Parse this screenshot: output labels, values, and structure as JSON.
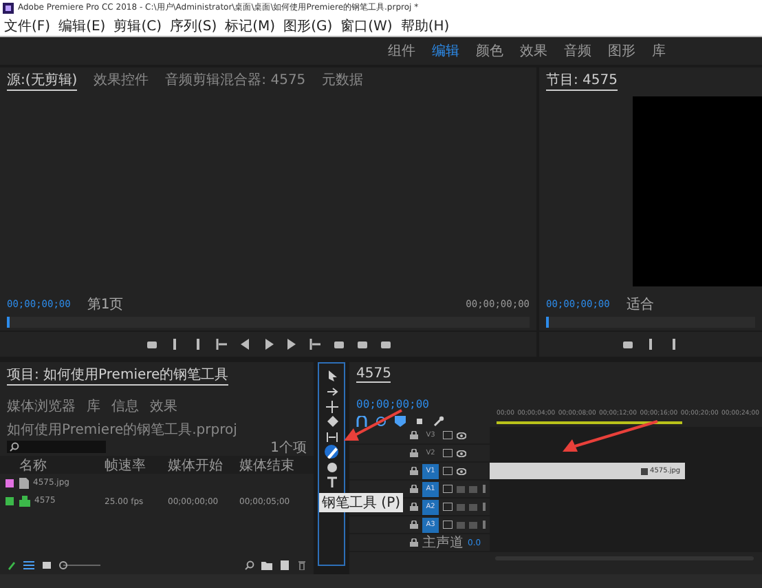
{
  "window": {
    "title": "Adobe Premiere Pro CC 2018 - C:\\用户\\Administrator\\桌面\\桌面\\如何使用Premiere的钢笔工具.prproj *"
  },
  "menu": [
    "文件(F)",
    "编辑(E)",
    "剪辑(C)",
    "序列(S)",
    "标记(M)",
    "图形(G)",
    "窗口(W)",
    "帮助(H)"
  ],
  "workspaces": [
    {
      "label": "组件",
      "selected": false
    },
    {
      "label": "编辑",
      "selected": true
    },
    {
      "label": "颜色",
      "selected": false
    },
    {
      "label": "效果",
      "selected": false
    },
    {
      "label": "音频",
      "selected": false
    },
    {
      "label": "图形",
      "selected": false
    },
    {
      "label": "库",
      "selected": false
    }
  ],
  "source_monitor": {
    "tabs": [
      {
        "label": "源:(无剪辑)",
        "selected": true
      },
      {
        "label": "效果控件",
        "selected": false
      },
      {
        "label": "音频剪辑混合器: 4575",
        "selected": false
      },
      {
        "label": "元数据",
        "selected": false
      }
    ],
    "timecode": "00;00;00;00",
    "page": "第1页",
    "duration": "00;00;00;00"
  },
  "program_monitor": {
    "tabs": [
      {
        "label": "节目: 4575",
        "selected": true
      }
    ],
    "timecode": "00;00;00;00",
    "zoom": "适合"
  },
  "project": {
    "tabs": [
      {
        "label": "项目: 如何使用Premiere的钢笔工具",
        "selected": true
      },
      {
        "label": "媒体浏览器",
        "selected": false
      },
      {
        "label": "库",
        "selected": false
      },
      {
        "label": "信息",
        "selected": false
      },
      {
        "label": "效果",
        "selected": false
      }
    ],
    "path": "如何使用Premiere的钢笔工具.prproj",
    "count": "1个项",
    "zoom_slider": {
      "level": 0
    },
    "columns": [
      "名称",
      "帧速率",
      "媒体开始",
      "媒体结束"
    ],
    "rows": [
      {
        "color": "#e070e0",
        "kind": "image",
        "name": "4575.jpg",
        "frame_rate": "",
        "start": "",
        "end": ""
      },
      {
        "color": "#3cb84a",
        "kind": "sequence",
        "name": "4575",
        "frame_rate": "25.00 fps",
        "start": "00;00;00;00",
        "end": "00;00;05;00"
      }
    ]
  },
  "tools": {
    "items": [
      {
        "kind": "select",
        "selected": false
      },
      {
        "kind": "track",
        "selected": false
      },
      {
        "kind": "ripple",
        "selected": false
      },
      {
        "kind": "razor",
        "selected": false
      },
      {
        "kind": "slip",
        "selected": false
      },
      {
        "kind": "pen",
        "selected": true
      },
      {
        "kind": "hand",
        "selected": false
      },
      {
        "kind": "text",
        "selected": false
      }
    ],
    "tooltip": "钢笔工具 (P)"
  },
  "timeline": {
    "tab": "4575",
    "timecode": "00;00;00;00",
    "ruler": [
      "00;00",
      "00;00;04;00",
      "00;00;08;00",
      "00;00;12;00",
      "00;00;16;00",
      "00;00;20;00",
      "00;00;24;00"
    ],
    "tracks": [
      {
        "label": "V3",
        "kind": "video",
        "targeted": false
      },
      {
        "label": "V2",
        "kind": "video",
        "targeted": false
      },
      {
        "label": "V1",
        "kind": "video",
        "targeted": true,
        "clip": "4575.jpg"
      },
      {
        "label": "A1",
        "kind": "audio",
        "targeted": true
      },
      {
        "label": "A2",
        "kind": "audio",
        "targeted": true
      },
      {
        "label": "A3",
        "kind": "audio",
        "targeted": true
      }
    ],
    "master": {
      "label": "主声道",
      "volume": "0.0"
    }
  }
}
